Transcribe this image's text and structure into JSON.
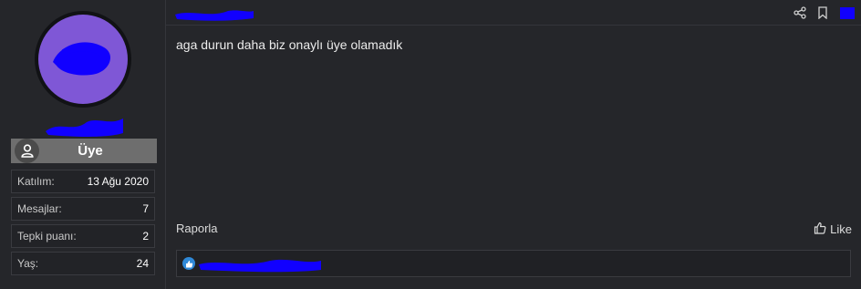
{
  "user": {
    "role_label": "Üye",
    "stats": [
      {
        "label": "Katılım:",
        "value": "13 Ağu 2020"
      },
      {
        "label": "Mesajlar:",
        "value": "7"
      },
      {
        "label": "Tepki puanı:",
        "value": "2"
      },
      {
        "label": "Yaş:",
        "value": "24"
      }
    ]
  },
  "post": {
    "message": "aga durun daha biz onaylı üye olamadık",
    "report_label": "Raporla",
    "like_label": "Like"
  },
  "colors": {
    "background": "#1b1c1f",
    "panel": "#25262a",
    "avatar_ring": "#111215",
    "avatar_fill": "#7f57d6",
    "redaction": "#1100ff",
    "role_bar": "#6e6e6e",
    "reaction_like": "#2f89d8"
  },
  "icons": [
    "user-icon",
    "share-icon",
    "bookmark-icon",
    "like-icon",
    "reaction-like-icon"
  ]
}
